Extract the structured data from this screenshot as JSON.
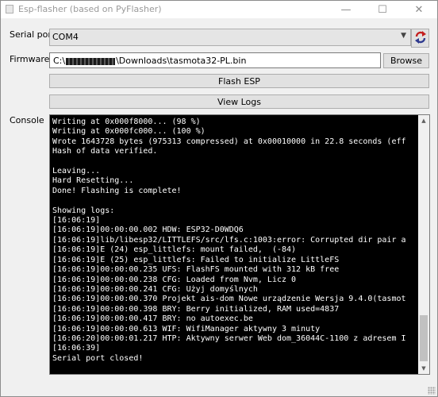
{
  "window": {
    "title": "Esp-flasher (based on PyFlasher)",
    "controls": {
      "minimize": "—",
      "maximize": "☐",
      "close": "✕"
    }
  },
  "serial_port": {
    "label": "Serial port",
    "value": "COM4",
    "refresh_icon": "refresh-arrows-icon"
  },
  "firmware": {
    "label": "Firmware",
    "path_prefix": "C:\\",
    "path_suffix": "\\Downloads\\tasmota32-PL.bin",
    "browse_label": "Browse"
  },
  "buttons": {
    "flash": "Flash ESP",
    "view_logs": "View Logs"
  },
  "console": {
    "label": "Console",
    "text": "Writing at 0x000f8000... (98 %)\nWriting at 0x000fc000... (100 %)\nWrote 1643728 bytes (975313 compressed) at 0x00010000 in 22.8 seconds (eff\nHash of data verified.\n\nLeaving...\nHard Resetting...\nDone! Flashing is complete!\n\nShowing logs:\n[16:06:19]\n[16:06:19]00:00:00.002 HDW: ESP32-D0WDQ6\n[16:06:19]lib/libesp32/LITTLEFS/src/lfs.c:1003:error: Corrupted dir pair a\n[16:06:19]E (24) esp_littlefs: mount failed,  (-84)\n[16:06:19]E (25) esp_littlefs: Failed to initialize LittleFS\n[16:06:19]00:00:00.235 UFS: FlashFS mounted with 312 kB free\n[16:06:19]00:00:00.238 CFG: Loaded from Nvm, Licz 0\n[16:06:19]00:00:00.241 CFG: Użyj domyślnych\n[16:06:19]00:00:00.370 Projekt ais-dom Nowe urządzenie Wersja 9.4.0(tasmot\n[16:06:19]00:00:00.398 BRY: Berry initialized, RAM used=4837\n[16:06:19]00:00:00.417 BRY: no autoexec.be\n[16:06:19]00:00:00.613 WIF: WifiManager aktywny 3 minuty\n[16:06:20]00:00:01.217 HTP: Aktywny serwer Web dom_36044C-1100 z adresem I\n[16:06:39]\nSerial port closed!"
  },
  "scrollbar": {
    "up_icon": "▲",
    "down_icon": "▼"
  }
}
